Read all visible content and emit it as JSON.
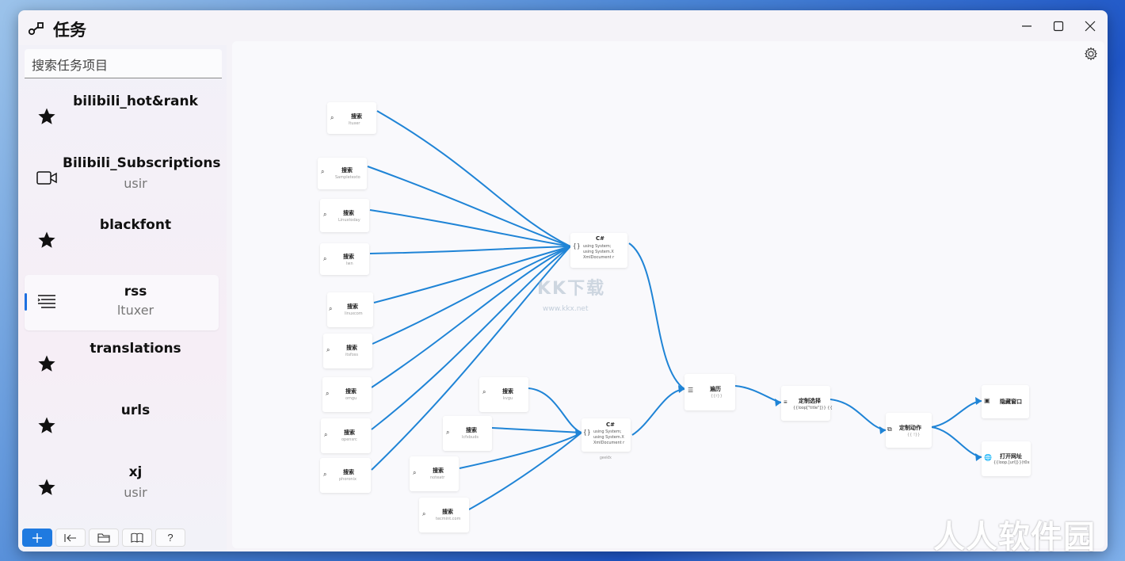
{
  "window": {
    "title": "任务"
  },
  "sidebar": {
    "search_placeholder": "搜索任务项目",
    "items": [
      {
        "name": "bilibili_hot&rank",
        "sub": "",
        "icon": "star-icon"
      },
      {
        "name": "Bilibili_Subscriptions",
        "sub": "usir",
        "icon": "video-camera-icon"
      },
      {
        "name": "blackfont",
        "sub": "",
        "icon": "star-icon"
      },
      {
        "name": "rss",
        "sub": "ltuxer",
        "icon": "rss-list-icon",
        "selected": true
      },
      {
        "name": "translations",
        "sub": "",
        "icon": "star-icon"
      },
      {
        "name": "urls",
        "sub": "",
        "icon": "star-icon"
      },
      {
        "name": "xj",
        "sub": "usir",
        "icon": "star-icon"
      }
    ],
    "toolbar": [
      "add-icon",
      "collapse-icon",
      "folder-icon",
      "book-icon",
      "help-icon"
    ],
    "toolbar_help": "?"
  },
  "canvas": {
    "nodes": {
      "s1": {
        "title": "搜索",
        "sub": "ltuxer"
      },
      "s2": {
        "title": "搜索",
        "sub": "Sampletexto"
      },
      "s3": {
        "title": "搜索",
        "sub": "Linuxtoday"
      },
      "s4": {
        "title": "搜索",
        "sub": "lwn"
      },
      "s5": {
        "title": "搜索",
        "sub": "linuxcom"
      },
      "s6": {
        "title": "搜索",
        "sub": "itsfoss"
      },
      "s7": {
        "title": "搜索",
        "sub": "omgu"
      },
      "s8": {
        "title": "搜索",
        "sub": "opensrc"
      },
      "s9": {
        "title": "搜索",
        "sub": "phoronix"
      },
      "s10": {
        "title": "搜索",
        "sub": "kvgu"
      },
      "s11": {
        "title": "搜索",
        "sub": "lcfxbuds"
      },
      "s12": {
        "title": "搜索",
        "sub": "noteatr"
      },
      "s13": {
        "title": "搜索",
        "sub": "tecmint.com"
      },
      "c1": {
        "title": "C#",
        "line1": "using System;",
        "line2": "using System.X",
        "line3": "XmlDocument r"
      },
      "c2": {
        "title": "C#",
        "line1": "using System;",
        "line2": "using System.X",
        "line3": "XmlDocument r",
        "caption": "geekfx"
      },
      "loop": {
        "title": "遍历",
        "sub": "{{r}}"
      },
      "select": {
        "title": "定制选择",
        "sub": "{{loop[\"title\"]}} {{"
      },
      "custom": {
        "title": "定制动作",
        "sub": "{{ !}}"
      },
      "hide": {
        "title": "隐藏窗口"
      },
      "open": {
        "title": "打开网址",
        "sub": "{{loop.[url]}}(t0x"
      }
    },
    "watermark_center": "KK下载",
    "watermark_center_url": "www.kkx.net"
  },
  "watermark_corner": "人人软件园",
  "colors": {
    "accent": "#1f7ae0",
    "connector": "#1f84d6"
  }
}
